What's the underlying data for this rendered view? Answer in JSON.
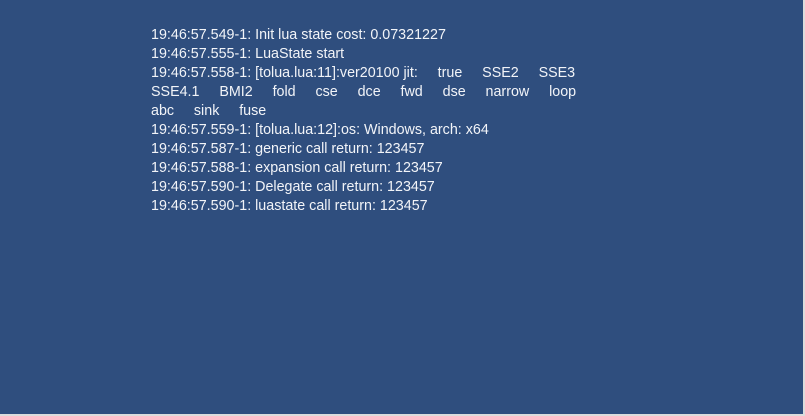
{
  "log": {
    "lines": [
      "19:46:57.549-1: Init lua state cost: 0.07321227",
      "19:46:57.555-1: LuaState start",
      "19:46:57.558-1: [tolua.lua:11]:ver20100 jit:     true     SSE2     SSE3",
      "SSE4.1     BMI2     fold     cse     dce     fwd     dse     narrow     loop",
      "abc     sink     fuse",
      "19:46:57.559-1: [tolua.lua:12]:os: Windows, arch: x64",
      "19:46:57.587-1: generic call return: 123457",
      "19:46:57.588-1: expansion call return: 123457",
      "19:46:57.590-1: Delegate call return: 123457",
      "19:46:57.590-1: luastate call return: 123457"
    ]
  }
}
